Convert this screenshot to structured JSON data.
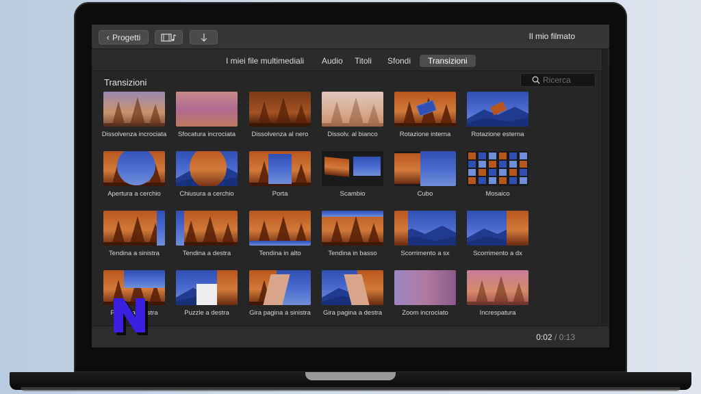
{
  "toolbar": {
    "back_label": "Progetti",
    "movie_title": "Il mio filmato"
  },
  "tabs": [
    {
      "label": "I miei file multimediali",
      "active": false
    },
    {
      "label": "Audio",
      "active": false
    },
    {
      "label": "Titoli",
      "active": false
    },
    {
      "label": "Sfondi",
      "active": false
    },
    {
      "label": "Transizioni",
      "active": true
    }
  ],
  "browser": {
    "section_title": "Transizioni",
    "search_placeholder": "Ricerca"
  },
  "transitions": [
    {
      "name": "Dissolvenza incrociata",
      "style": "cross"
    },
    {
      "name": "Sfocatura incrociata",
      "style": "blur"
    },
    {
      "name": "Dissolvenza al nero",
      "style": "dark"
    },
    {
      "name": "Dissolv. al bianco",
      "style": "white"
    },
    {
      "name": "Rotazione interna",
      "style": "spin-in"
    },
    {
      "name": "Rotazione esterna",
      "style": "spin-out"
    },
    {
      "name": "Apertura a cerchio",
      "style": "circle-open"
    },
    {
      "name": "Chiusura a cerchio",
      "style": "circle-close"
    },
    {
      "name": "Porta",
      "style": "doorway"
    },
    {
      "name": "Scambio",
      "style": "swap"
    },
    {
      "name": "Cubo",
      "style": "cube"
    },
    {
      "name": "Mosaico",
      "style": "mosaic"
    },
    {
      "name": "Tendina a sinistra",
      "style": "wipe-left"
    },
    {
      "name": "Tendina a destra",
      "style": "wipe-right"
    },
    {
      "name": "Tendina in alto",
      "style": "wipe-up"
    },
    {
      "name": "Tendina in basso",
      "style": "wipe-down"
    },
    {
      "name": "Scorrimento a sx",
      "style": "slide-left"
    },
    {
      "name": "Scorrimento a dx",
      "style": "slide-right"
    },
    {
      "name": "Puzzle a sinistra",
      "style": "puzzle-left"
    },
    {
      "name": "Puzzle a destra",
      "style": "puzzle-right"
    },
    {
      "name": "Gira pagina a sinistra",
      "style": "page-left"
    },
    {
      "name": "Gira pagina a destra",
      "style": "page-right"
    },
    {
      "name": "Zoom incrociato",
      "style": "zoom"
    },
    {
      "name": "Increspatura",
      "style": "ripple"
    }
  ],
  "playback": {
    "current": "0:02",
    "separator": "/",
    "total": "0:13"
  },
  "colors": {
    "forest": "#b8561e",
    "forest_dark": "#6a2a10",
    "sky": "#2f4fb3",
    "mountain": "#6f8fd8"
  }
}
